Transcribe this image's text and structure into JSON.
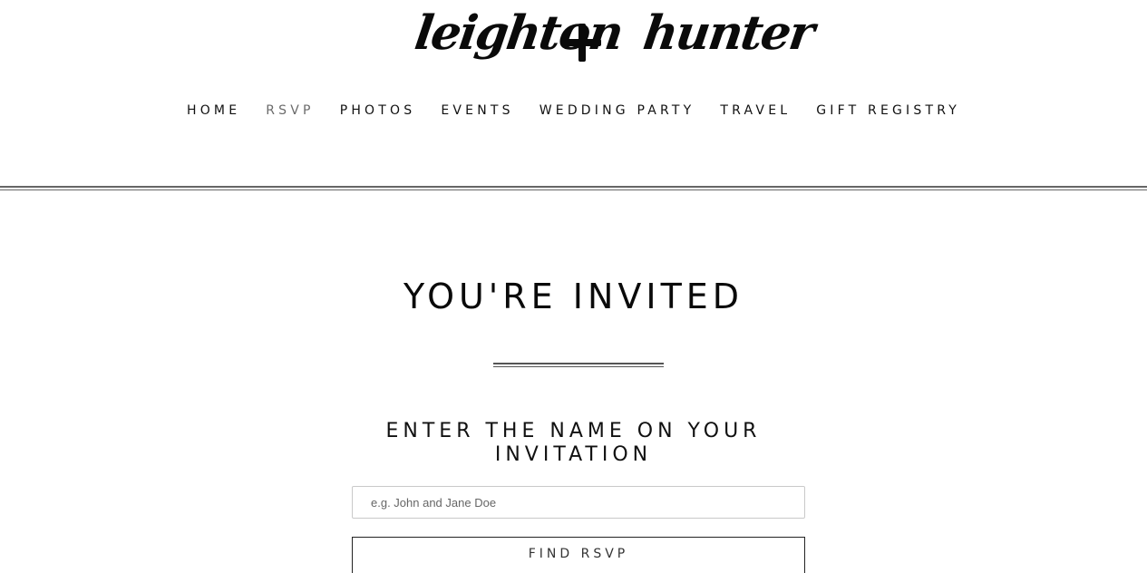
{
  "header": {
    "logo": {
      "left_name": "leighton",
      "connector": "+",
      "right_name": "hunter"
    },
    "nav": {
      "items": [
        {
          "label": "HOME",
          "active": false
        },
        {
          "label": "RSVP",
          "active": true
        },
        {
          "label": "PHOTOS",
          "active": false
        },
        {
          "label": "EVENTS",
          "active": false
        },
        {
          "label": "WEDDING PARTY",
          "active": false
        },
        {
          "label": "TRAVEL",
          "active": false
        },
        {
          "label": "GIFT REGISTRY",
          "active": false
        }
      ]
    }
  },
  "main": {
    "title": "YOU'RE INVITED",
    "prompt_line1": "ENTER THE NAME ON YOUR",
    "prompt_line2": "INVITATION",
    "name_input": {
      "value": "",
      "placeholder": "e.g. John and Jane Doe"
    },
    "find_button_label": "FIND RSVP"
  },
  "colors": {
    "background": "#ffffff",
    "text": "#111111",
    "nav_active": "#6b6b6b",
    "rule": "#666666",
    "input_border": "#c9c9c9"
  }
}
